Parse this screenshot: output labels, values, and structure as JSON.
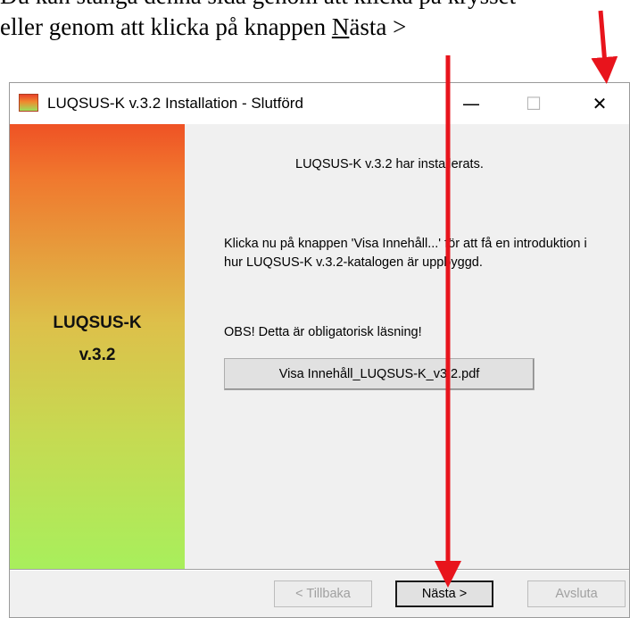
{
  "instruction": {
    "line1": "Du kan stänga denna sida genom att klicka på krysset",
    "line2_pre": "eller genom att klicka på knappen ",
    "line2_u": "N",
    "line2_post": "ästa >"
  },
  "window": {
    "title": "LUQSUS-K v.3.2 Installation - Slutförd",
    "controls": {
      "minimize": "—",
      "maximize": "☐",
      "close": "✕"
    }
  },
  "sidebar": {
    "title1": "LUQSUS-K",
    "title2": "v.3.2"
  },
  "content": {
    "heading": "LUQSUS-K v.3.2 har installerats.",
    "paragraph": "Klicka nu på knappen 'Visa Innehåll...' för att få en introduktion i hur LUQSUS-K v.3.2-katalogen är uppbyggd.",
    "obs": "OBS! Detta är obligatorisk läsning!",
    "pdf_button": "Visa Innehåll_LUQSUS-K_v3.2.pdf"
  },
  "footer": {
    "back": "< Tillbaka",
    "next": "Nästa >",
    "cancel": "Avsluta"
  },
  "colors": {
    "arrow": "#e8141c",
    "sidebar_top": "#ef5225",
    "sidebar_bottom": "#a8ef5c"
  }
}
